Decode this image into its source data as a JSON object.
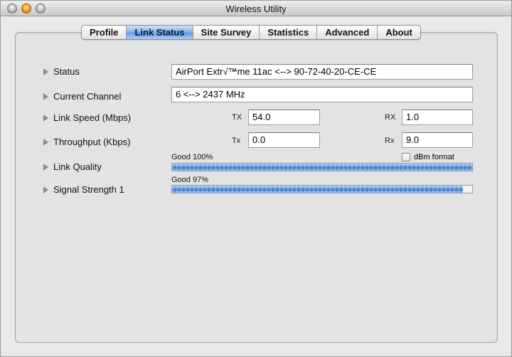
{
  "window": {
    "title": "Wireless Utility"
  },
  "tabs": [
    {
      "label": "Profile",
      "active": false
    },
    {
      "label": "Link Status",
      "active": true
    },
    {
      "label": "Site Survey",
      "active": false
    },
    {
      "label": "Statistics",
      "active": false
    },
    {
      "label": "Advanced",
      "active": false
    },
    {
      "label": "About",
      "active": false
    }
  ],
  "status": {
    "label": "Status",
    "value": "AirPort Extr√™me 11ac <--> 90-72-40-20-CE-CE"
  },
  "channel": {
    "label": "Current Channel",
    "value": "6 <--> 2437 MHz"
  },
  "link_speed": {
    "label": "Link Speed (Mbps)",
    "tx_label": "TX",
    "tx_value": "54.0",
    "rx_label": "RX",
    "rx_value": "1.0"
  },
  "throughput": {
    "label": "Throughput (Kbps)",
    "tx_label": "Tx",
    "tx_value": "0.0",
    "rx_label": "Rx",
    "rx_value": "9.0"
  },
  "link_quality": {
    "label": "Link Quality",
    "bar_text": "Good 100%",
    "percent": 100
  },
  "signal_strength": {
    "label": "Signal Strength 1",
    "bar_text": "Good 97%",
    "percent": 97
  },
  "dbm_format": {
    "label": "dBm format",
    "checked": false
  },
  "colors": {
    "accent": "#4f8fe0",
    "tab_active": "#7fb2ee"
  }
}
